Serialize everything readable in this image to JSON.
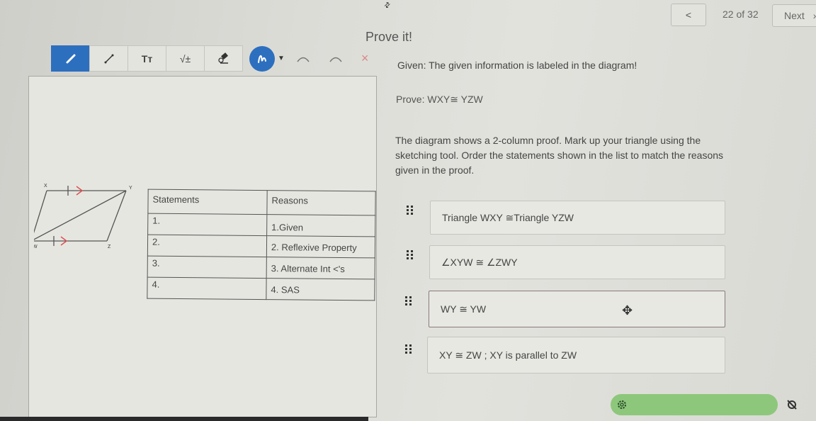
{
  "nav": {
    "prev_icon": "chevron-left-icon",
    "prev_glyph": "<",
    "count": "22 of 32",
    "next_label": "Next",
    "next_glyph": "›"
  },
  "title": "Prove it!",
  "toolbar": {
    "tools": [
      {
        "name": "pencil-tool",
        "icon": "pencil-icon",
        "active": true
      },
      {
        "name": "line-tool",
        "icon": "line-icon",
        "active": false
      },
      {
        "name": "text-tool",
        "icon": "text-icon",
        "label": "Tт",
        "active": false
      },
      {
        "name": "math-tool",
        "icon": "math-icon",
        "label": "√±",
        "active": false
      },
      {
        "name": "eraser-tool",
        "icon": "eraser-icon",
        "active": false
      }
    ],
    "color_picker_icon": "squiggle-icon",
    "dropdown_glyph": "▼",
    "undo_icon": "undo-icon",
    "redo_icon": "redo-icon",
    "clear_glyph": "×"
  },
  "diagram": {
    "vertices": [
      "X",
      "Y",
      "W",
      "Z"
    ],
    "accent_color": "#e05050"
  },
  "proof_table": {
    "headers": [
      "Statements",
      "Reasons"
    ],
    "rows": [
      {
        "statement": "1.",
        "reason": "1.Given"
      },
      {
        "statement": "2.",
        "reason": "2. Reflexive Property"
      },
      {
        "statement": "3.",
        "reason": "3. Alternate Int <'s"
      },
      {
        "statement": "4.",
        "reason": "4. SAS"
      }
    ]
  },
  "given": "Given: The given information is labeled in the diagram!",
  "prove": "Prove:  WXY≅ YZW",
  "instructions": "The diagram shows a 2-column proof.  Mark up your triangle using the sketching tool.  Order the statements shown in the list to match the reasons given in the proof.",
  "statements": [
    "Triangle WXY ≅Triangle YZW",
    "∠XYW ≅ ∠ZWY",
    "WY ≅ YW",
    "XY ≅ ZW ; XY is parallel to ZW"
  ],
  "move_glyph": "✥",
  "bottom": {
    "settings_icon": "gear-icon",
    "right_icon": "hide-icon",
    "bar_color": "#8dc77b"
  }
}
